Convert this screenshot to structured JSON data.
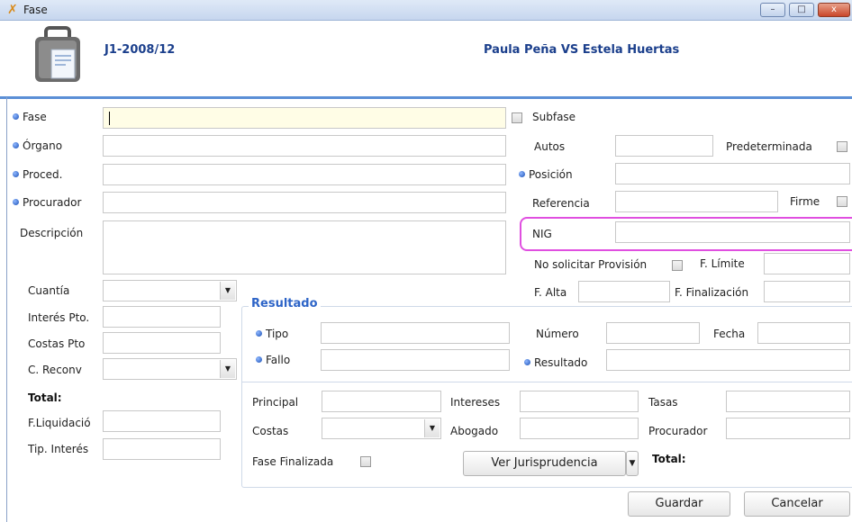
{
  "window": {
    "title": "Fase",
    "minimize": "–",
    "maximize": "□",
    "close": "x"
  },
  "header": {
    "case_number": "J1-2008/12",
    "parties": "Paula Peña VS Estela Huertas"
  },
  "left": {
    "fase_label": "Fase",
    "organo_label": "Órgano",
    "proced_label": "Proced.",
    "procurador_label": "Procurador",
    "descripcion_label": "Descripción",
    "cuantia_label": "Cuantía",
    "interes_pto_label": "Interés Pto.",
    "costas_pto_label": "Costas Pto",
    "c_reconv_label": "C. Reconv",
    "total_label": "Total:",
    "f_liquidacion_label": "F.Liquidació",
    "tip_interes_label": "Tip. Interés"
  },
  "right": {
    "subfase_label": "Subfase",
    "autos_label": "Autos",
    "predeterminada_label": "Predeterminada",
    "posicion_label": "Posición",
    "referencia_label": "Referencia",
    "firme_label": "Firme",
    "nig_label": "NIG",
    "no_solicitar_label": "No solicitar Provisión",
    "f_limite_label": "F. Límite",
    "f_alta_label": "F. Alta",
    "f_finalizacion_label": "F. Finalización"
  },
  "resultado": {
    "legend": "Resultado",
    "tipo_label": "Tipo",
    "numero_label": "Número",
    "fecha_label": "Fecha",
    "fallo_label": "Fallo",
    "resultado_label": "Resultado"
  },
  "financial": {
    "principal_label": "Principal",
    "intereses_label": "Intereses",
    "tasas_label": "Tasas",
    "costas_label": "Costas",
    "abogado_label": "Abogado",
    "procurador_label": "Procurador",
    "fase_finalizada_label": "Fase Finalizada",
    "ver_jurisprudencia_label": "Ver Jurisprudencia",
    "total_label": "Total:"
  },
  "actions": {
    "save_label": "Guardar",
    "cancel_label": "Cancelar"
  }
}
